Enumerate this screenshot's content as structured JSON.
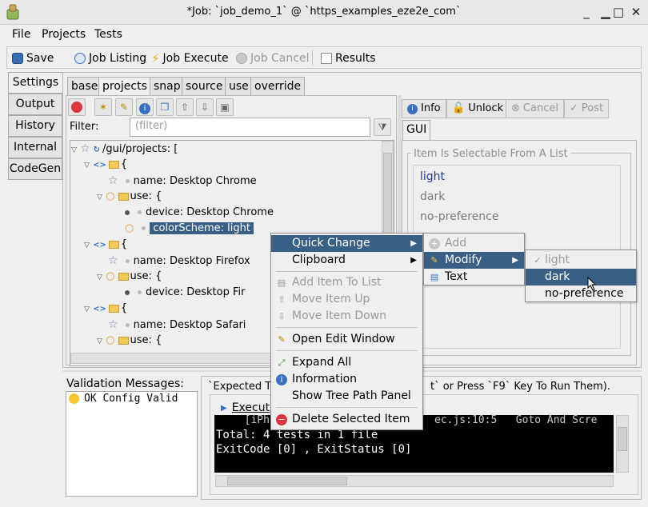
{
  "window": {
    "title": "*Job: `job_demo_1` @ `https_examples_eze2e_com`",
    "controls": [
      "_",
      "□",
      "✕"
    ]
  },
  "menubar": {
    "file": "File",
    "projects": "Projects",
    "tests": "Tests"
  },
  "toolbar": {
    "save": "Save",
    "job_listing": "Job Listing",
    "job_execute": "Job Execute",
    "job_cancel": "Job Cancel",
    "results": "Results"
  },
  "left_tabs": [
    "Settings",
    "Output",
    "History",
    "Internal",
    "CodeGen"
  ],
  "settings_tabs": [
    "base",
    "projects",
    "snap",
    "source",
    "use",
    "override"
  ],
  "filter": {
    "label": "Filter:",
    "placeholder": "(filter)"
  },
  "tree": {
    "rows": [
      {
        "text": "/gui/projects: ["
      },
      {
        "text": "{"
      },
      {
        "text": "name: Desktop Chrome"
      },
      {
        "text": "use: {"
      },
      {
        "text": "device: Desktop Chrome"
      },
      {
        "text": "colorScheme: light"
      },
      {
        "text": "{"
      },
      {
        "text": "name: Desktop Firefox"
      },
      {
        "text": "use: {"
      },
      {
        "text": "device: Desktop Fir"
      },
      {
        "text": "{"
      },
      {
        "text": "name: Desktop Safari"
      },
      {
        "text": "use: {"
      }
    ]
  },
  "right_panel": {
    "buttons": {
      "info": "Info",
      "unlock": "Unlock",
      "cancel": "Cancel",
      "post": "Post"
    },
    "tab": "GUI",
    "group_title": "Item Is Selectable From A List",
    "options": [
      "light",
      "dark",
      "no-preference"
    ]
  },
  "validation": {
    "label": "Validation Messages:",
    "message": "OK Config Valid"
  },
  "output": {
    "header": "`Expected T",
    "header_tail": "t` or Press `F9` Key To Run Them).",
    "execute": "Execut",
    "lines": [
      "  [iPhon",
      "ec.js:10:5   Goto And Scre",
      "Total: 4 tests in 1 file",
      "ExitCode [0] , ExitStatus [0]"
    ]
  },
  "context_menu": {
    "items": [
      "Quick Change",
      "Clipboard",
      "Add Item To List",
      "Move Item Up",
      "Move Item Down",
      "Open Edit Window",
      "Expand All",
      "Information",
      "Show Tree Path Panel",
      "Delete Selected Item"
    ]
  },
  "submenu": {
    "items": [
      "Add",
      "Modify",
      "Text"
    ]
  },
  "modify_menu": {
    "items": [
      "light",
      "dark",
      "no-preference"
    ]
  },
  "colors": {
    "selection": "#3a5f84",
    "console_bg": "#000000"
  }
}
